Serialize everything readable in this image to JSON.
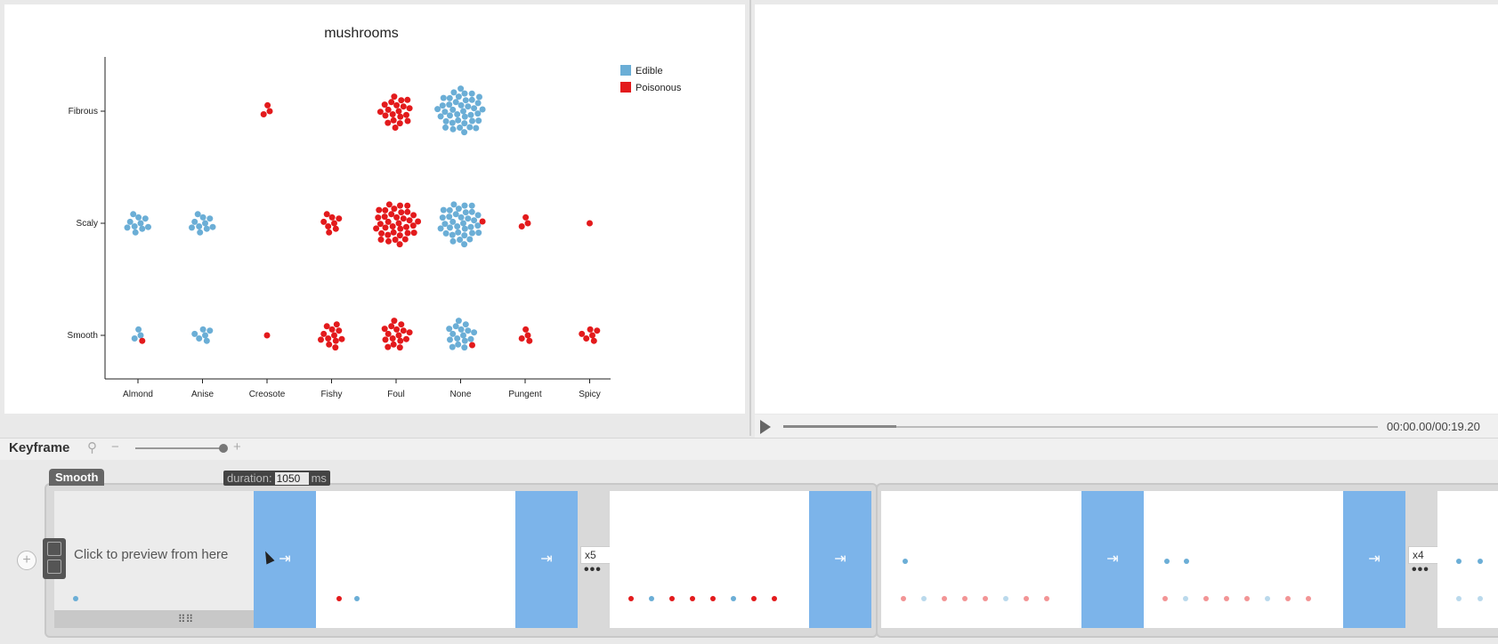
{
  "chart_data": {
    "type": "scatter",
    "title": "mushrooms",
    "x_categories": [
      "Almond",
      "Anise",
      "Creosote",
      "Fishy",
      "Foul",
      "None",
      "Pungent",
      "Spicy"
    ],
    "y_categories": [
      "Fibrous",
      "Scaly",
      "Smooth"
    ],
    "legend": [
      {
        "name": "Edible",
        "color": "#6baed6"
      },
      {
        "name": "Poisonous",
        "color": "#e31a1c"
      }
    ],
    "legend_placement": "top-right",
    "clusters": [
      {
        "x": "Creosote",
        "y": "Fibrous",
        "edible": 0,
        "poisonous": 3
      },
      {
        "x": "Foul",
        "y": "Fibrous",
        "edible": 0,
        "poisonous": 20
      },
      {
        "x": "None",
        "y": "Fibrous",
        "edible": 40,
        "poisonous": 0
      },
      {
        "x": "Almond",
        "y": "Scaly",
        "edible": 10,
        "poisonous": 0
      },
      {
        "x": "Anise",
        "y": "Scaly",
        "edible": 10,
        "poisonous": 0
      },
      {
        "x": "Fishy",
        "y": "Scaly",
        "edible": 0,
        "poisonous": 8
      },
      {
        "x": "Foul",
        "y": "Scaly",
        "edible": 0,
        "poisonous": 36
      },
      {
        "x": "None",
        "y": "Scaly",
        "edible": 34,
        "poisonous": 1
      },
      {
        "x": "Pungent",
        "y": "Scaly",
        "edible": 0,
        "poisonous": 3
      },
      {
        "x": "Spicy",
        "y": "Scaly",
        "edible": 0,
        "poisonous": 1
      },
      {
        "x": "Almond",
        "y": "Smooth",
        "edible": 3,
        "poisonous": 1
      },
      {
        "x": "Anise",
        "y": "Smooth",
        "edible": 6,
        "poisonous": 0
      },
      {
        "x": "Creosote",
        "y": "Smooth",
        "edible": 0,
        "poisonous": 1
      },
      {
        "x": "Fishy",
        "y": "Smooth",
        "edible": 0,
        "poisonous": 12
      },
      {
        "x": "Foul",
        "y": "Smooth",
        "edible": 0,
        "poisonous": 16
      },
      {
        "x": "None",
        "y": "Smooth",
        "edible": 16,
        "poisonous": 1
      },
      {
        "x": "Pungent",
        "y": "Smooth",
        "edible": 0,
        "poisonous": 4
      },
      {
        "x": "Spicy",
        "y": "Smooth",
        "edible": 0,
        "poisonous": 6
      }
    ]
  },
  "player": {
    "time": "00:00.00/00:19.20",
    "progress": 0.19
  },
  "keyframe": {
    "label": "Keyframe",
    "zoom_level": 0.95
  },
  "timeline": {
    "group_tag": "Smooth",
    "duration_label": "duration:",
    "duration_value": "1050",
    "duration_unit": "ms",
    "preview_text": "Click to preview from here",
    "repeat1": "x5",
    "repeat2": "x4",
    "more": "•••"
  },
  "colors": {
    "edible": "#6baed6",
    "poisonous": "#e31a1c",
    "transition": "#7cb4ea"
  },
  "icons": [
    "search-icon",
    "zoom-out-icon",
    "zoom-in-icon",
    "play-icon",
    "add-icon",
    "arrow-right-bar-icon",
    "drag-handle-icon"
  ]
}
